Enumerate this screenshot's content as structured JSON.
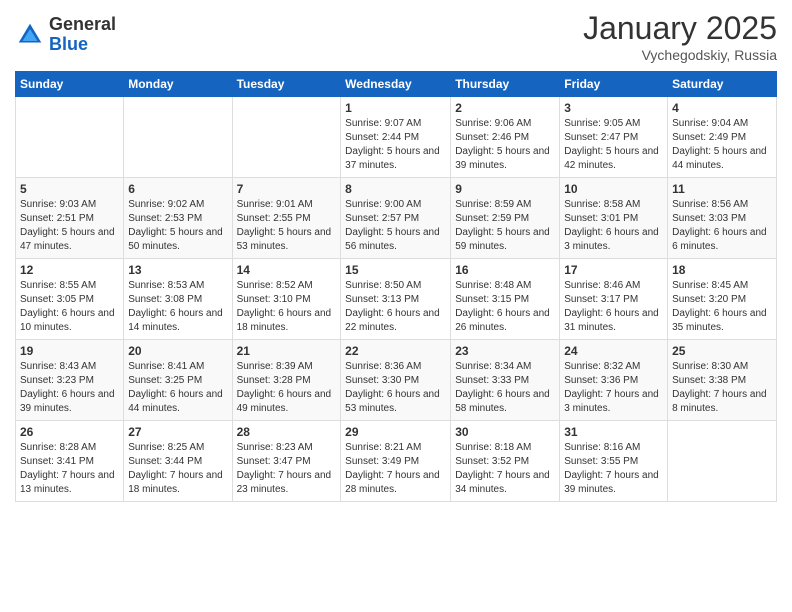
{
  "header": {
    "logo": {
      "general": "General",
      "blue": "Blue"
    },
    "title": "January 2025",
    "location": "Vychegodskiy, Russia"
  },
  "days_of_week": [
    "Sunday",
    "Monday",
    "Tuesday",
    "Wednesday",
    "Thursday",
    "Friday",
    "Saturday"
  ],
  "weeks": [
    [
      {
        "day": null,
        "info": null
      },
      {
        "day": null,
        "info": null
      },
      {
        "day": null,
        "info": null
      },
      {
        "day": "1",
        "info": "Sunrise: 9:07 AM\nSunset: 2:44 PM\nDaylight: 5 hours and 37 minutes."
      },
      {
        "day": "2",
        "info": "Sunrise: 9:06 AM\nSunset: 2:46 PM\nDaylight: 5 hours and 39 minutes."
      },
      {
        "day": "3",
        "info": "Sunrise: 9:05 AM\nSunset: 2:47 PM\nDaylight: 5 hours and 42 minutes."
      },
      {
        "day": "4",
        "info": "Sunrise: 9:04 AM\nSunset: 2:49 PM\nDaylight: 5 hours and 44 minutes."
      }
    ],
    [
      {
        "day": "5",
        "info": "Sunrise: 9:03 AM\nSunset: 2:51 PM\nDaylight: 5 hours and 47 minutes."
      },
      {
        "day": "6",
        "info": "Sunrise: 9:02 AM\nSunset: 2:53 PM\nDaylight: 5 hours and 50 minutes."
      },
      {
        "day": "7",
        "info": "Sunrise: 9:01 AM\nSunset: 2:55 PM\nDaylight: 5 hours and 53 minutes."
      },
      {
        "day": "8",
        "info": "Sunrise: 9:00 AM\nSunset: 2:57 PM\nDaylight: 5 hours and 56 minutes."
      },
      {
        "day": "9",
        "info": "Sunrise: 8:59 AM\nSunset: 2:59 PM\nDaylight: 5 hours and 59 minutes."
      },
      {
        "day": "10",
        "info": "Sunrise: 8:58 AM\nSunset: 3:01 PM\nDaylight: 6 hours and 3 minutes."
      },
      {
        "day": "11",
        "info": "Sunrise: 8:56 AM\nSunset: 3:03 PM\nDaylight: 6 hours and 6 minutes."
      }
    ],
    [
      {
        "day": "12",
        "info": "Sunrise: 8:55 AM\nSunset: 3:05 PM\nDaylight: 6 hours and 10 minutes."
      },
      {
        "day": "13",
        "info": "Sunrise: 8:53 AM\nSunset: 3:08 PM\nDaylight: 6 hours and 14 minutes."
      },
      {
        "day": "14",
        "info": "Sunrise: 8:52 AM\nSunset: 3:10 PM\nDaylight: 6 hours and 18 minutes."
      },
      {
        "day": "15",
        "info": "Sunrise: 8:50 AM\nSunset: 3:13 PM\nDaylight: 6 hours and 22 minutes."
      },
      {
        "day": "16",
        "info": "Sunrise: 8:48 AM\nSunset: 3:15 PM\nDaylight: 6 hours and 26 minutes."
      },
      {
        "day": "17",
        "info": "Sunrise: 8:46 AM\nSunset: 3:17 PM\nDaylight: 6 hours and 31 minutes."
      },
      {
        "day": "18",
        "info": "Sunrise: 8:45 AM\nSunset: 3:20 PM\nDaylight: 6 hours and 35 minutes."
      }
    ],
    [
      {
        "day": "19",
        "info": "Sunrise: 8:43 AM\nSunset: 3:23 PM\nDaylight: 6 hours and 39 minutes."
      },
      {
        "day": "20",
        "info": "Sunrise: 8:41 AM\nSunset: 3:25 PM\nDaylight: 6 hours and 44 minutes."
      },
      {
        "day": "21",
        "info": "Sunrise: 8:39 AM\nSunset: 3:28 PM\nDaylight: 6 hours and 49 minutes."
      },
      {
        "day": "22",
        "info": "Sunrise: 8:36 AM\nSunset: 3:30 PM\nDaylight: 6 hours and 53 minutes."
      },
      {
        "day": "23",
        "info": "Sunrise: 8:34 AM\nSunset: 3:33 PM\nDaylight: 6 hours and 58 minutes."
      },
      {
        "day": "24",
        "info": "Sunrise: 8:32 AM\nSunset: 3:36 PM\nDaylight: 7 hours and 3 minutes."
      },
      {
        "day": "25",
        "info": "Sunrise: 8:30 AM\nSunset: 3:38 PM\nDaylight: 7 hours and 8 minutes."
      }
    ],
    [
      {
        "day": "26",
        "info": "Sunrise: 8:28 AM\nSunset: 3:41 PM\nDaylight: 7 hours and 13 minutes."
      },
      {
        "day": "27",
        "info": "Sunrise: 8:25 AM\nSunset: 3:44 PM\nDaylight: 7 hours and 18 minutes."
      },
      {
        "day": "28",
        "info": "Sunrise: 8:23 AM\nSunset: 3:47 PM\nDaylight: 7 hours and 23 minutes."
      },
      {
        "day": "29",
        "info": "Sunrise: 8:21 AM\nSunset: 3:49 PM\nDaylight: 7 hours and 28 minutes."
      },
      {
        "day": "30",
        "info": "Sunrise: 8:18 AM\nSunset: 3:52 PM\nDaylight: 7 hours and 34 minutes."
      },
      {
        "day": "31",
        "info": "Sunrise: 8:16 AM\nSunset: 3:55 PM\nDaylight: 7 hours and 39 minutes."
      },
      {
        "day": null,
        "info": null
      }
    ]
  ]
}
